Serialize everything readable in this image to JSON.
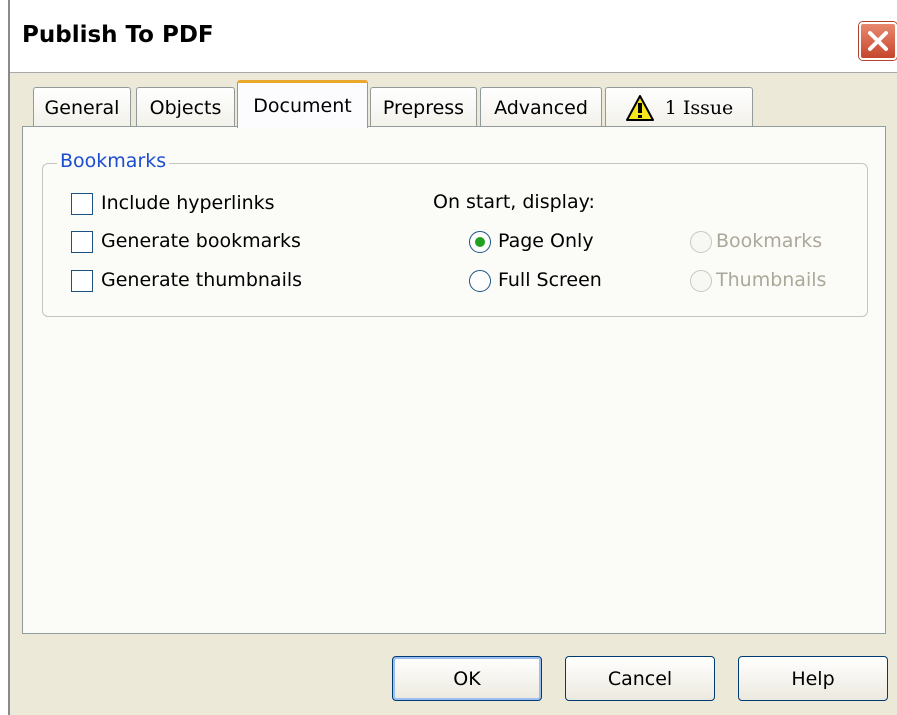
{
  "window": {
    "title": "Publish To PDF",
    "close_icon": "close-icon",
    "accent_color": "#1c4dcf"
  },
  "tabs": [
    {
      "label": "General",
      "active": false
    },
    {
      "label": "Objects",
      "active": false
    },
    {
      "label": "Document",
      "active": true
    },
    {
      "label": "Prepress",
      "active": false
    },
    {
      "label": "Advanced",
      "active": false
    },
    {
      "label": "1 Issue",
      "active": false,
      "icon": "warning-icon"
    }
  ],
  "bookmarks": {
    "legend": "Bookmarks",
    "checkboxes": [
      {
        "label": "Include hyperlinks",
        "checked": false
      },
      {
        "label": "Generate bookmarks",
        "checked": false
      },
      {
        "label": "Generate thumbnails",
        "checked": false
      }
    ],
    "display_label": "On start, display:",
    "radios": [
      {
        "label": "Page Only",
        "selected": true,
        "enabled": true
      },
      {
        "label": "Full Screen",
        "selected": false,
        "enabled": true
      },
      {
        "label": "Bookmarks",
        "selected": false,
        "enabled": false
      },
      {
        "label": "Thumbnails",
        "selected": false,
        "enabled": false
      }
    ]
  },
  "buttons": {
    "ok": "OK",
    "cancel": "Cancel",
    "help": "Help"
  }
}
